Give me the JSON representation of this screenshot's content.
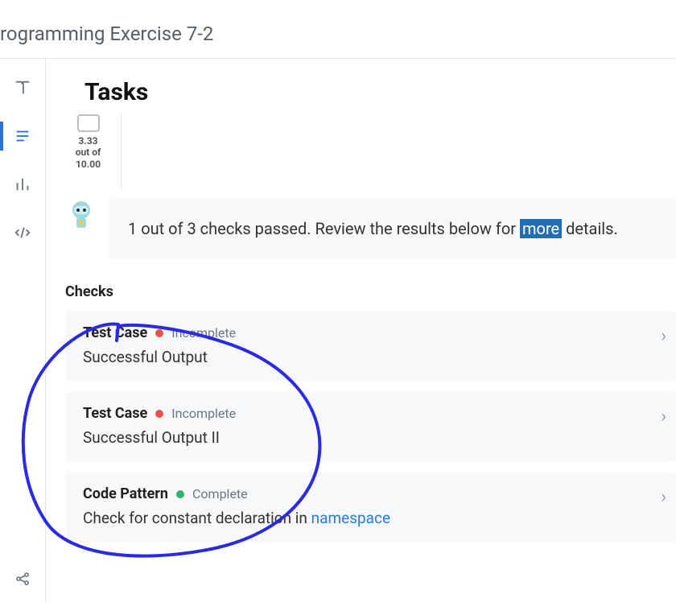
{
  "header": {
    "page_title": "rogramming Exercise 7-2"
  },
  "tasks_title": "Tasks",
  "score": {
    "value": "3.33",
    "out_of_label": "out of",
    "total": "10.00"
  },
  "message": {
    "text_before": "1 out of 3 checks passed. Review the results below for ",
    "link_text": "more",
    "text_after": " details."
  },
  "checks": {
    "heading": "Checks",
    "items": [
      {
        "type_label": "Test Case",
        "status_label": "Incomplete",
        "status_color": "red",
        "description": "Successful Output"
      },
      {
        "type_label": "Test Case",
        "status_label": "Incomplete",
        "status_color": "red",
        "description": "Successful Output II"
      },
      {
        "type_label": "Code Pattern",
        "status_label": "Complete",
        "status_color": "green",
        "description_prefix": "Check for constant declaration in ",
        "description_link": "namespace"
      }
    ]
  }
}
